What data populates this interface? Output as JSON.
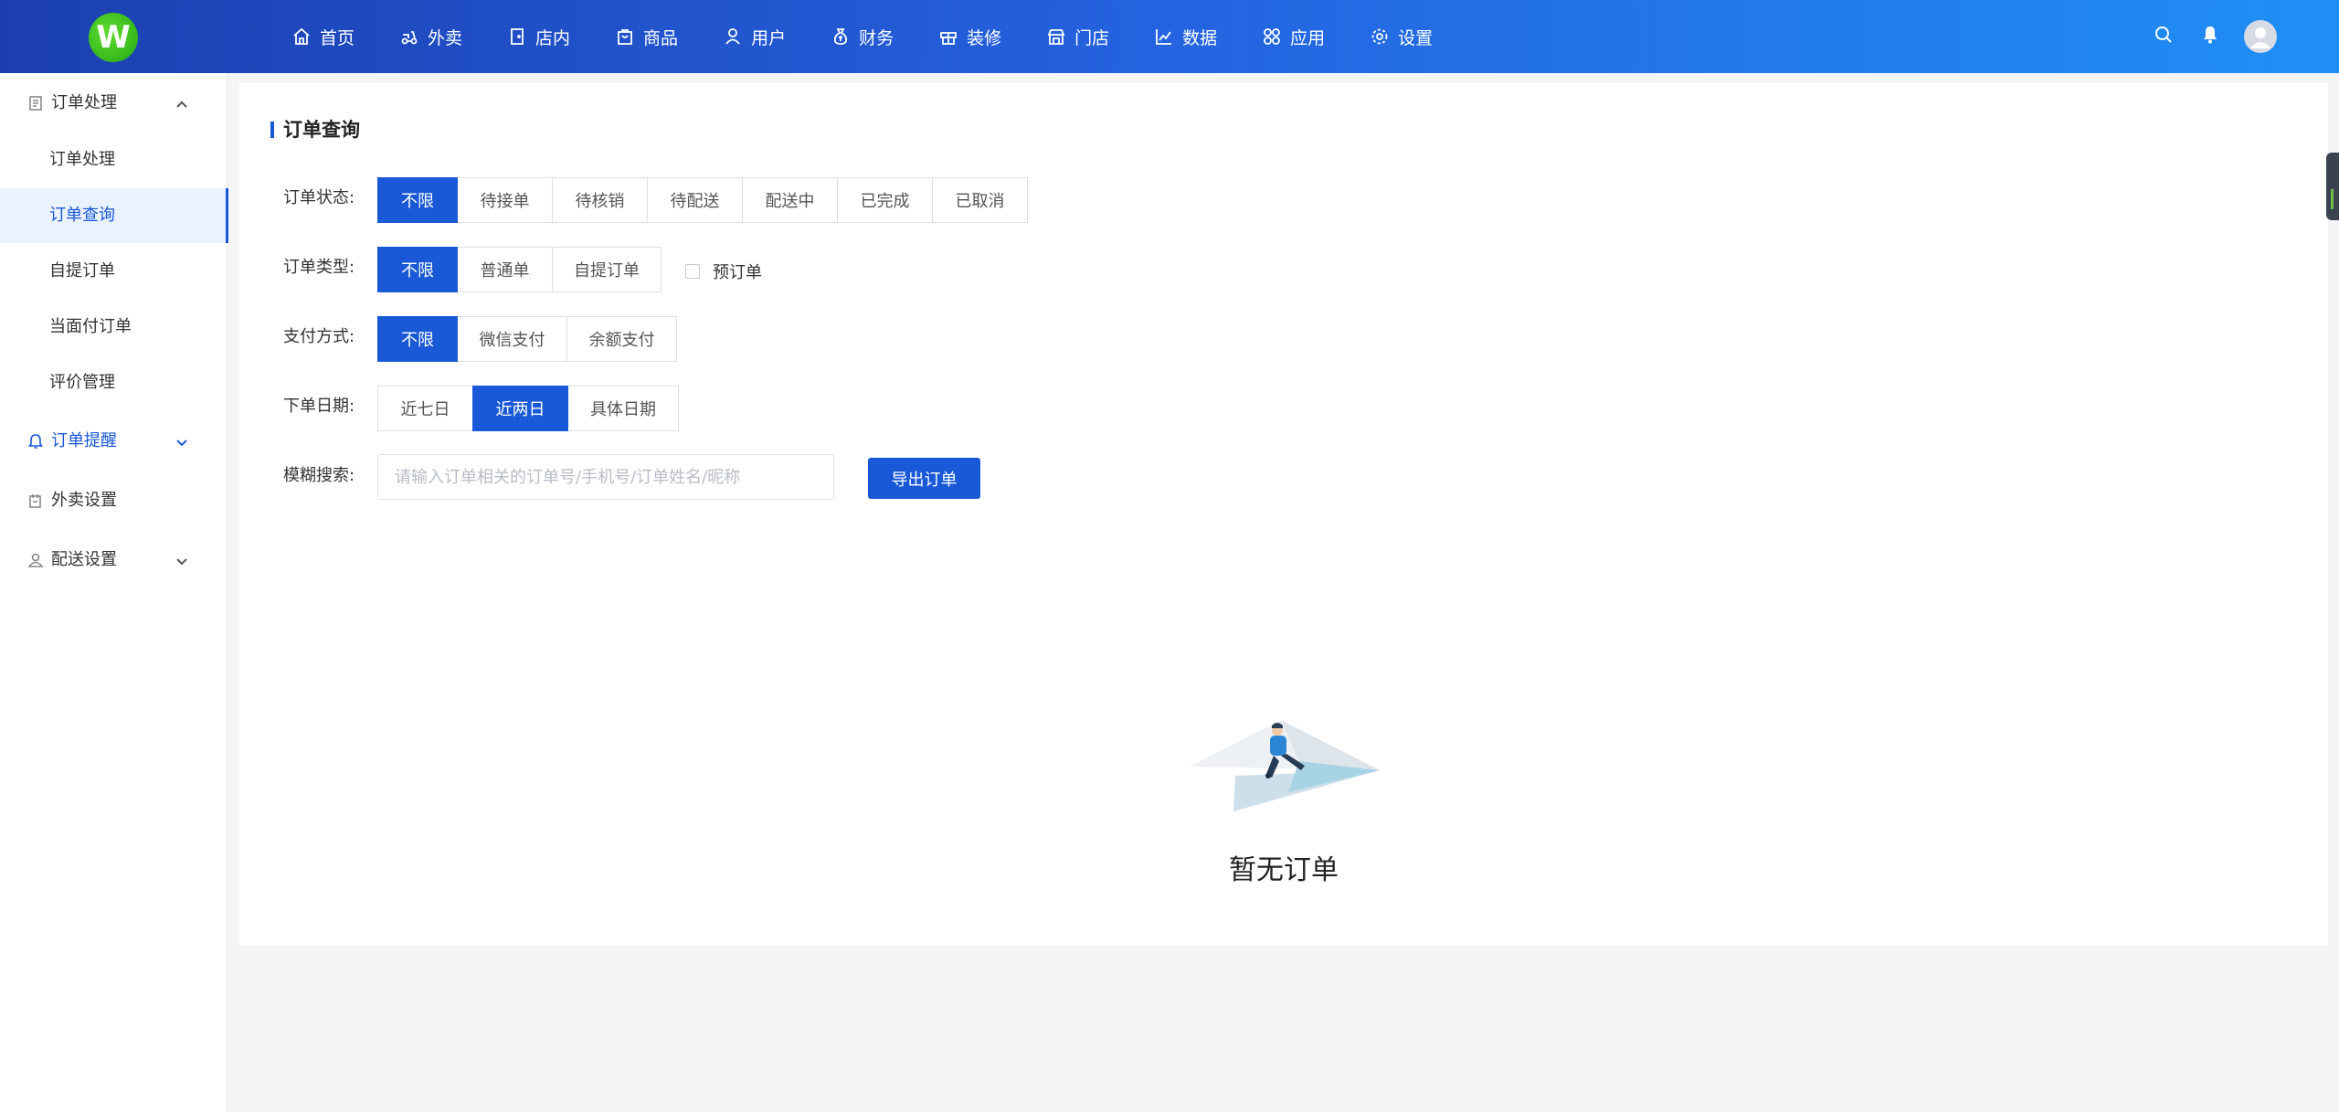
{
  "logo": {
    "letter": "W",
    "color": "#3cc21c"
  },
  "colors": {
    "primary": "#1958d6",
    "topbar_start": "#1c3fb0",
    "topbar_end": "#1f8ff5"
  },
  "nav": [
    {
      "label": "首页",
      "icon": "home-icon"
    },
    {
      "label": "外卖",
      "icon": "scooter-icon"
    },
    {
      "label": "店内",
      "icon": "store-door-icon"
    },
    {
      "label": "商品",
      "icon": "bag-icon"
    },
    {
      "label": "用户",
      "icon": "user-icon"
    },
    {
      "label": "财务",
      "icon": "money-bag-icon"
    },
    {
      "label": "装修",
      "icon": "gift-icon"
    },
    {
      "label": "门店",
      "icon": "shop-icon"
    },
    {
      "label": "数据",
      "icon": "chart-line-icon"
    },
    {
      "label": "应用",
      "icon": "apps-icon"
    },
    {
      "label": "设置",
      "icon": "gear-icon"
    }
  ],
  "sidebar": {
    "group1": {
      "label": "订单处理",
      "icon": "document-icon",
      "expanded": true
    },
    "subitems": [
      {
        "label": "订单处理",
        "active": false
      },
      {
        "label": "订单查询",
        "active": true
      },
      {
        "label": "自提订单",
        "active": false
      },
      {
        "label": "当面付订单",
        "active": false
      },
      {
        "label": "评价管理",
        "active": false
      }
    ],
    "group2": {
      "label": "订单提醒",
      "icon": "bell-icon"
    },
    "group3": {
      "label": "外卖设置",
      "icon": "takeout-settings-icon"
    },
    "group4": {
      "label": "配送设置",
      "icon": "delivery-icon"
    }
  },
  "page": {
    "title": "订单查询",
    "filters": {
      "status": {
        "label": "订单状态:",
        "options": [
          "不限",
          "待接单",
          "待核销",
          "待配送",
          "配送中",
          "已完成",
          "已取消"
        ],
        "selected": "不限"
      },
      "type": {
        "label": "订单类型:",
        "options": [
          "不限",
          "普通单",
          "自提订单"
        ],
        "selected": "不限",
        "checkbox_label": "预订单",
        "checkbox_checked": false
      },
      "payment": {
        "label": "支付方式:",
        "options": [
          "不限",
          "微信支付",
          "余额支付"
        ],
        "selected": "不限"
      },
      "date": {
        "label": "下单日期:",
        "options": [
          "近七日",
          "近两日",
          "具体日期"
        ],
        "selected": "近两日"
      },
      "search": {
        "label": "模糊搜索:",
        "placeholder": "请输入订单相关的订单号/手机号/订单姓名/昵称",
        "value": ""
      }
    },
    "export_button": "导出订单",
    "empty_text": "暂无订单"
  }
}
